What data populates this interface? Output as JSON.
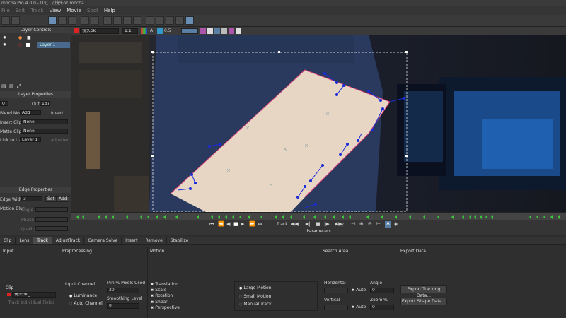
{
  "window": {
    "title": "mocha Pro 4.0.0 - D:\\\\...\\\\镜头ok.mocha"
  },
  "menu": [
    {
      "label": "File",
      "dim": true
    },
    {
      "label": "Edit",
      "dim": true
    },
    {
      "label": "Track",
      "dim": true
    },
    {
      "label": "View",
      "dim": false
    },
    {
      "label": "Movie",
      "dim": false
    },
    {
      "label": "Spot",
      "dim": true
    },
    {
      "label": "Help",
      "dim": false
    }
  ],
  "viewer_bar": {
    "clip": "镜头ok_",
    "zoom": "1:1",
    "opacity": "0.5",
    "channel": "A"
  },
  "layer_controls": {
    "title": "Layer Controls",
    "layer_name": "Layer 1"
  },
  "layer_properties": {
    "title": "Layer Properties",
    "in_value": "0",
    "out_label": "Out",
    "out_value": "157",
    "blend_mode_label": "Blend Mode",
    "blend_mode": "Add",
    "invert_label": "Invert",
    "insert_clip_label": "Insert Clip",
    "insert_clip": "None",
    "matte_clip_label": "Matte Clip",
    "matte_clip": "None",
    "link_label": "Link to track",
    "link_value": "Layer 1",
    "adjusted_label": "Adjusted"
  },
  "edge_properties": {
    "title": "Edge Properties",
    "edge_width_label": "Edge Width",
    "edge_width": "3",
    "set_label": "Set",
    "add_label": "Add",
    "motion_blur_label": "Motion Blur",
    "angle_label": "Angle",
    "phase_label": "Phase",
    "quality_label": "Quality"
  },
  "transport": {
    "track_label": "Track",
    "key_label": "Key",
    "params_label": "Parameters"
  },
  "tabs": [
    "Clip",
    "Lens",
    "Track",
    "AdjustTrack",
    "Camera Solve",
    "Insert",
    "Remove",
    "Stabilize"
  ],
  "active_tab": "Track",
  "params": {
    "input_title": "Input",
    "preprocessing_title": "Preprocessing",
    "motion_title": "Motion",
    "search_area_title": "Search Area",
    "export_title": "Export Data",
    "clip_label": "Clip",
    "clip_value": "镜头ok_",
    "track_individual": "Track Individual Fields",
    "input_channel_label": "Input Channel",
    "luminance": "Luminance",
    "auto_channel": "Auto Channel",
    "min_pixels_label": "Min % Pixels Used",
    "min_pixels": "20",
    "smoothing_label": "Smoothing Level",
    "smoothing": "0",
    "motion_checks": [
      "Translation",
      "Scale",
      "Rotation",
      "Shear",
      "Perspective"
    ],
    "large_motion": "Large Motion",
    "small_motion": "Small Motion",
    "manual_track": "Manual Track",
    "horizontal_label": "Horizontal",
    "vertical_label": "Vertical",
    "auto_label": "Auto",
    "angle_label": "Angle",
    "angle_value": "0",
    "zoom_label": "Zoom %",
    "zoom_value": "0",
    "export_tracking": "Export Tracking Data...",
    "export_shape": "Export Shape Data..."
  },
  "colors": {
    "accent": "#6a8fb5",
    "spline": "#1a2ad8",
    "layer": "#4a6a8d",
    "keyframe": "#3cc83c"
  }
}
